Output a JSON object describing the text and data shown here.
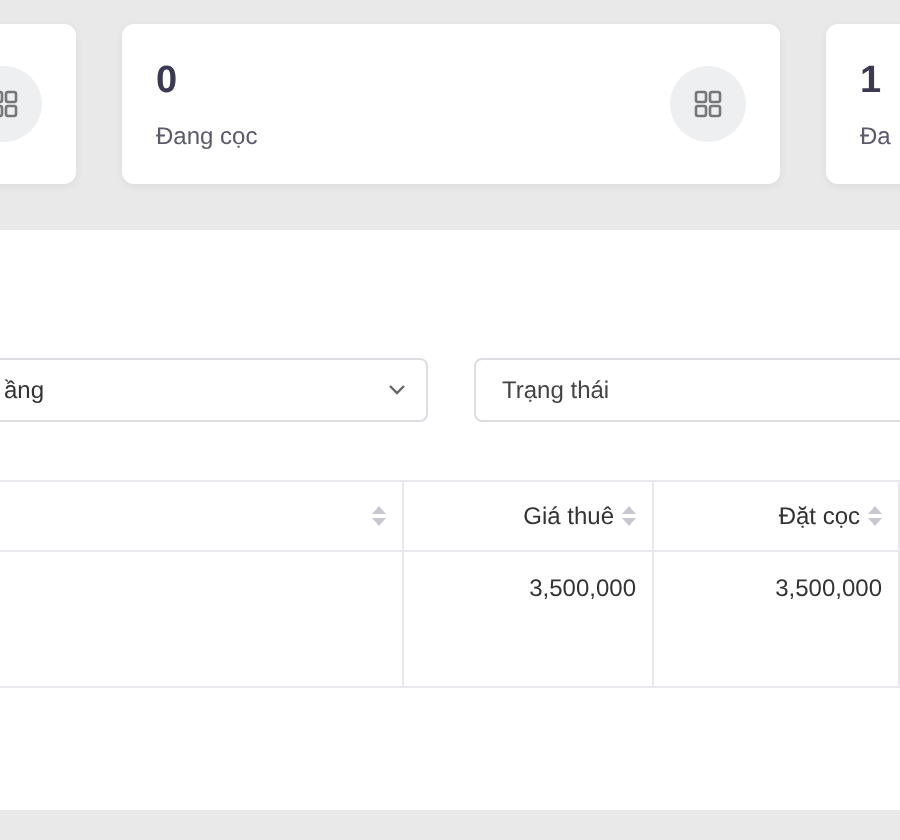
{
  "stats": [
    {
      "value": "0",
      "label": "Đang cọc"
    },
    {
      "value": "1",
      "label": "Đa"
    }
  ],
  "filters": [
    {
      "kind": "select",
      "value": "ầng"
    },
    {
      "kind": "input",
      "placeholder": "Trạng thái"
    }
  ],
  "table": {
    "columns": [
      "",
      "Giá thuê",
      "Đặt cọc"
    ],
    "rows": [
      [
        "",
        "3,500,000",
        "3,500,000"
      ]
    ]
  }
}
